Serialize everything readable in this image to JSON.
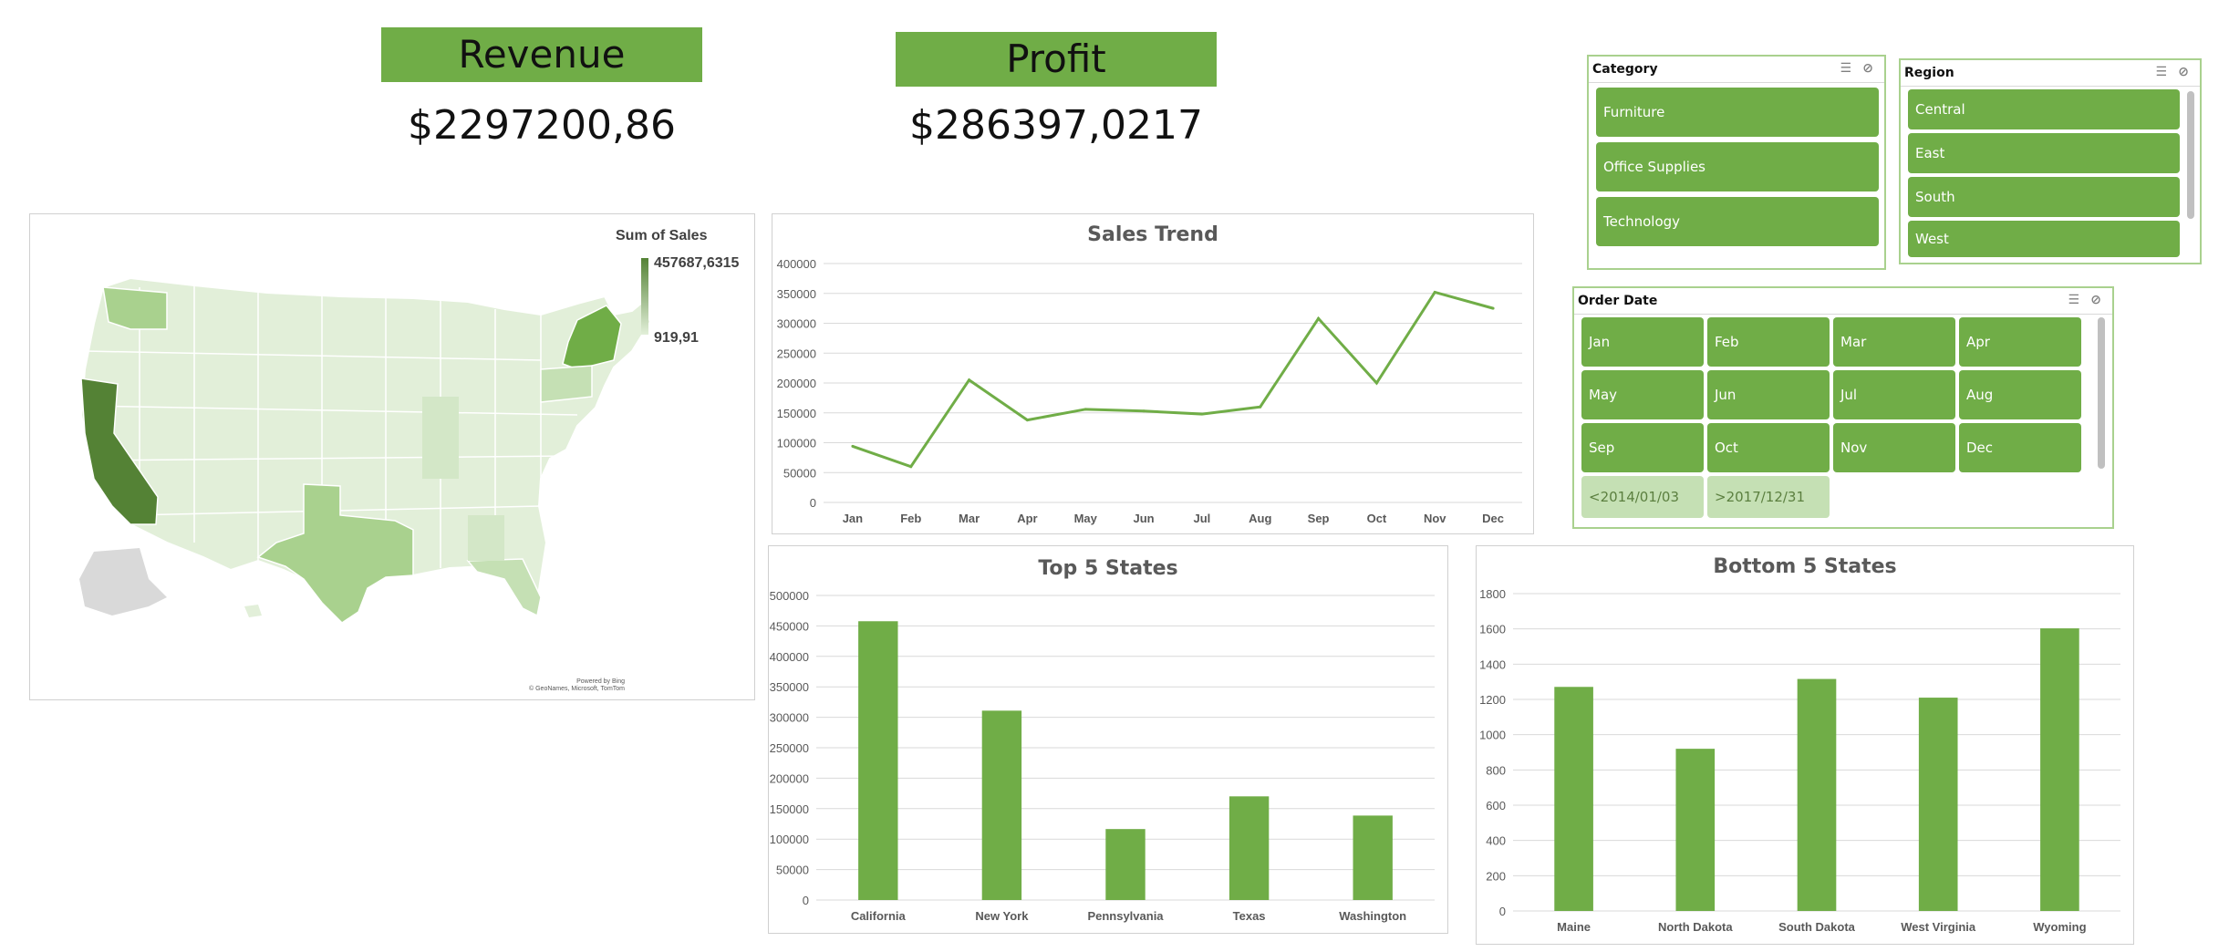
{
  "kpis": {
    "revenue": {
      "label": "Revenue",
      "value": "$2297200,86"
    },
    "profit": {
      "label": "Profit",
      "value": "$286397,0217"
    }
  },
  "map": {
    "legend_title": "Sum of Sales",
    "legend_max": "457687,6315",
    "legend_min": "919,91",
    "credit_line1": "Powered by Bing",
    "credit_line2": "© GeoNames, Microsoft, TomTom"
  },
  "slicers": {
    "category": {
      "title": "Category",
      "items": [
        "Furniture",
        "Office Supplies",
        "Technology"
      ]
    },
    "region": {
      "title": "Region",
      "items": [
        "Central",
        "East",
        "South",
        "West"
      ]
    },
    "order_date": {
      "title": "Order Date",
      "items": [
        "Jan",
        "Feb",
        "Mar",
        "Apr",
        "May",
        "Jun",
        "Jul",
        "Aug",
        "Sep",
        "Oct",
        "Nov",
        "Dec"
      ],
      "extra_items": [
        "<2014/01/03",
        ">2017/12/31"
      ]
    }
  },
  "colors": {
    "accent": "#70ad47",
    "accent_light": "#c5e0b4",
    "axis_text": "#595959",
    "grid": "#d9d9d9"
  },
  "chart_data": [
    {
      "type": "line",
      "title": "Sales Trend",
      "categories": [
        "Jan",
        "Feb",
        "Mar",
        "Apr",
        "May",
        "Jun",
        "Jul",
        "Aug",
        "Sep",
        "Oct",
        "Nov",
        "Dec"
      ],
      "values": [
        94000,
        60000,
        205000,
        138000,
        156000,
        153000,
        148000,
        160000,
        308000,
        200000,
        352000,
        325000
      ],
      "yticks": [
        "0",
        "50000",
        "100000",
        "150000",
        "200000",
        "250000",
        "300000",
        "350000",
        "400000"
      ],
      "ylim": [
        0,
        400000
      ]
    },
    {
      "type": "bar",
      "title": "Top 5 States",
      "categories": [
        "California",
        "New York",
        "Pennsylvania",
        "Texas",
        "Washington"
      ],
      "values": [
        457687,
        310876,
        116512,
        170188,
        138641
      ],
      "yticks": [
        "0",
        "50000",
        "100000",
        "150000",
        "200000",
        "250000",
        "300000",
        "350000",
        "400000",
        "450000",
        "500000"
      ],
      "ylim": [
        0,
        500000
      ]
    },
    {
      "type": "bar",
      "title": "Bottom 5 States",
      "categories": [
        "Maine",
        "North Dakota",
        "South Dakota",
        "West Virginia",
        "Wyoming"
      ],
      "values": [
        1271,
        920,
        1316,
        1210,
        1603
      ],
      "yticks": [
        "0",
        "200",
        "400",
        "600",
        "800",
        "1000",
        "1200",
        "1400",
        "1600",
        "1800"
      ],
      "ylim": [
        0,
        1800
      ]
    }
  ]
}
